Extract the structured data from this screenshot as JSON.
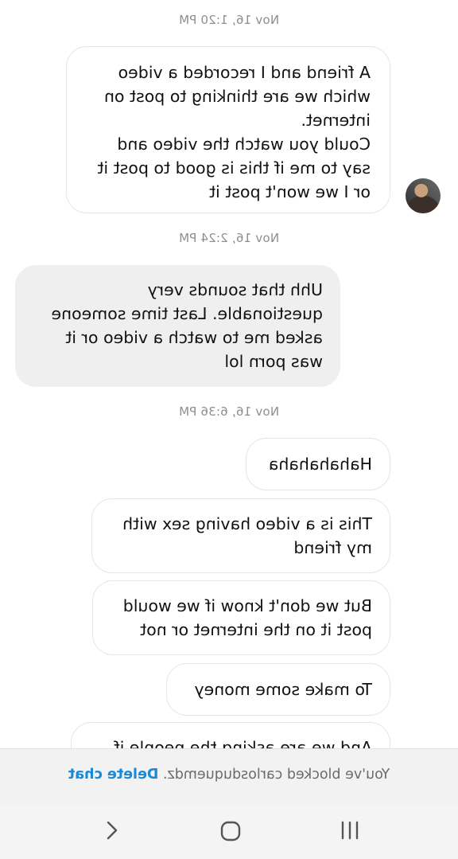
{
  "messages": [
    {
      "type": "timestamp",
      "text": "Nov 16, 1:20 PM"
    },
    {
      "type": "received",
      "lines": [
        "A friend and I recorded a video",
        "which we are thinking to post on",
        "internet.",
        "Could you watch the video and",
        "say to me if this is good to post it",
        "or I we won't post it"
      ]
    },
    {
      "type": "timestamp",
      "text": "Nov 16, 2:24 PM"
    },
    {
      "type": "sent",
      "lines": [
        "Uhh that sounds very",
        "questionable. Last time someone",
        "asked me to watch a video or it",
        "was porn lol"
      ]
    },
    {
      "type": "timestamp",
      "text": "Nov 16, 6:36 PM"
    },
    {
      "type": "received",
      "lines": [
        "Hahahahaha"
      ]
    },
    {
      "type": "received",
      "lines": [
        "This is a video having sex with",
        "my friend"
      ]
    },
    {
      "type": "received",
      "lines": [
        "But we don't know if we would",
        "post it on the internet or not"
      ]
    },
    {
      "type": "received",
      "lines": [
        "To make some money"
      ]
    },
    {
      "type": "received",
      "lines": [
        "And we are asking the people if"
      ]
    }
  ],
  "blocked_bar": {
    "text": "You've blocked carlosduquemdz.",
    "action": "Delete chat"
  },
  "nav": {
    "recents_icon": "recents-icon",
    "home_icon": "home-icon",
    "back_icon": "back-icon"
  }
}
